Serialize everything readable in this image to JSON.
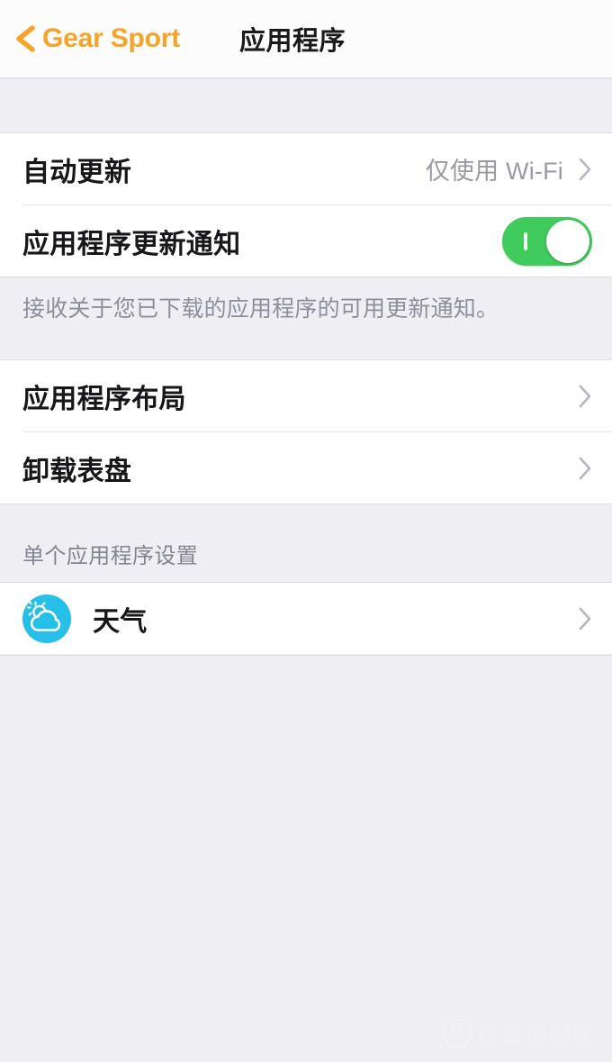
{
  "header": {
    "back_label": "Gear Sport",
    "back_icon": "chevron-left-icon",
    "title": "应用程序",
    "accent_color": "#f6a32a"
  },
  "sections": [
    {
      "rows": [
        {
          "label": "自动更新",
          "value": "仅使用 Wi-Fi",
          "accessory": "chevron-right-icon"
        },
        {
          "label": "应用程序更新通知",
          "accessory": "toggle-switch",
          "toggle_on": true,
          "toggle_color": "#3fcc5c"
        }
      ],
      "description": "接收关于您已下载的应用程序的可用更新通知。"
    },
    {
      "rows": [
        {
          "label": "应用程序布局",
          "accessory": "chevron-right-icon"
        },
        {
          "label": "卸载表盘",
          "accessory": "chevron-right-icon"
        }
      ]
    },
    {
      "section_title": "单个应用程序设置",
      "rows": [
        {
          "label": "天气",
          "icon": "weather-sun-cloud-icon",
          "icon_color": "#25bfe8",
          "accessory": "chevron-right-icon"
        }
      ]
    }
  ],
  "watermark": {
    "badge": "值",
    "text": "什么值得买"
  }
}
